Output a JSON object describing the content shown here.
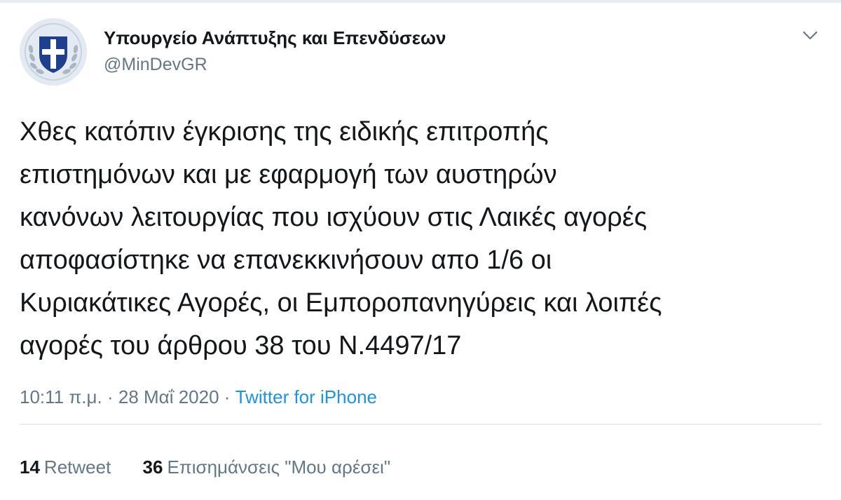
{
  "author": {
    "display_name": "Υπουργείο Ανάπτυξης και Επενδύσεων",
    "handle": "@MinDevGR",
    "avatar_icon": "greek-cross-emblem-icon"
  },
  "menu_icon": "chevron-down-icon",
  "tweet": {
    "text": "Χθες κατόπιν έγκρισης της ειδικής επιτροπής\nεπιστημόνων και με εφαρμογή των αυστηρών\nκανόνων λειτουργίας που ισχύουν στις Λαικές αγορές\nαποφασίστηκε να επανεκκινήσουν απο 1/6 οι\nΚυριακάτικες Αγορές, οι Εμποροπανηγύρεις και λοιπές\nαγορές του άρθρου 38 του Ν.4497/17"
  },
  "meta": {
    "time": "10:11 π.μ.",
    "separator": "·",
    "date": "28 Μαΐ 2020",
    "source": "Twitter for iPhone"
  },
  "stats": {
    "retweets_count": "14",
    "retweets_label": "Retweet",
    "likes_count": "36",
    "likes_label": "Επισημάνσεις \"Μου αρέσει\""
  },
  "colors": {
    "text": "#14171a",
    "secondary": "#657786",
    "link": "#1b95e0",
    "divider": "#e6ecf0",
    "emblem_blue": "#1f3f8f"
  }
}
